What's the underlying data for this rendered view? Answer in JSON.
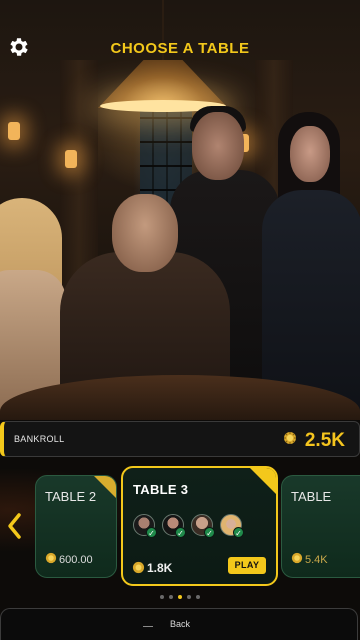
{
  "header": {
    "title": "CHOOSE A TABLE",
    "settings_icon": "gear-icon"
  },
  "bankroll": {
    "label": "BANKROLL",
    "amount": "2.5K",
    "icon": "chip-icon"
  },
  "carousel": {
    "cards": [
      {
        "name": "TABLE 2",
        "value": "600.00"
      },
      {
        "name": "TABLE 3",
        "value": "1.8K",
        "play_label": "PLAY",
        "players": 4
      },
      {
        "name": "TABLE",
        "value": "5.4K"
      }
    ],
    "selected_index": 1,
    "page_indicator": {
      "count": 5,
      "active": 2
    }
  },
  "footer": {
    "back_label": "Back"
  },
  "colors": {
    "accent": "#F3C81B",
    "card_green": "#19392A",
    "check_green": "#1F8A4A"
  }
}
